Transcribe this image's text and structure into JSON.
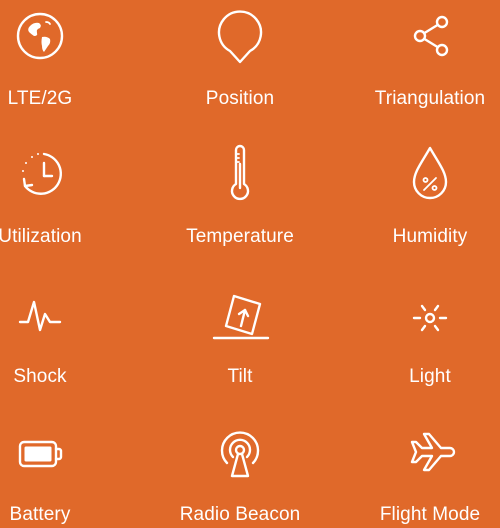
{
  "background_color": "#e0692a",
  "foreground_color": "#ffffff",
  "features": [
    {
      "label": "LTE/2G",
      "icon": "globe-icon"
    },
    {
      "label": "Position",
      "icon": "map-pin-icon"
    },
    {
      "label": "Triangulation",
      "icon": "share-nodes-icon"
    },
    {
      "label": "Utilization",
      "icon": "clock-history-icon"
    },
    {
      "label": "Temperature",
      "icon": "thermometer-icon"
    },
    {
      "label": "Humidity",
      "icon": "water-drop-percent-icon"
    },
    {
      "label": "Shock",
      "icon": "pulse-icon"
    },
    {
      "label": "Tilt",
      "icon": "tilt-box-icon"
    },
    {
      "label": "Light",
      "icon": "light-burst-icon"
    },
    {
      "label": "Battery",
      "icon": "battery-icon"
    },
    {
      "label": "Radio Beacon",
      "icon": "radio-beacon-icon"
    },
    {
      "label": "Flight Mode",
      "icon": "airplane-icon"
    }
  ]
}
